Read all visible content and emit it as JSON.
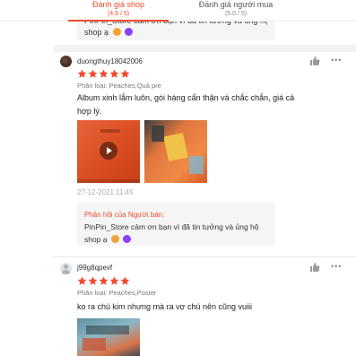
{
  "tabs": {
    "shop": {
      "label": "Đánh giá shop",
      "score": "(4.9 / 5)"
    },
    "buyer": {
      "label": "Đánh giá người mua",
      "score": "(5.0 / 5)"
    }
  },
  "top_reply": {
    "line1": "PinPin_Store cảm ơn bạn vì đã tin tưởng và ủng hộ",
    "line2": "shop ạ"
  },
  "reviews": [
    {
      "username": "duongthuy18042006",
      "rating": 5,
      "variant": "Phân loại: Peaches,Quà pre",
      "text": "Album xinh lắm luôn, gói hàng cẩn thận và chắc chắn, giá cả hợp lý.",
      "media": [
        "video",
        "image"
      ],
      "timestamp": "27-12-2021 11:45",
      "reply": {
        "title": "Phản hồi của Người bán:",
        "text_line1": "PinPin_Store cảm ơn bạn vì đã tin tưởng và ủng hộ",
        "text_line2": "shop ạ"
      }
    },
    {
      "username": "j99g8qpevf",
      "rating": 5,
      "variant": "Phân loại: Peaches,Poster",
      "text": "ko ra chú kim nhưng mà ra vợ chú nên cũng  vuiii",
      "media": [
        "image"
      ]
    }
  ],
  "icons": {
    "like": "thumbs-up-icon",
    "more": "more-options-icon",
    "star": "star-icon",
    "play": "play-icon",
    "emoji_face": "smiling-face-emoji",
    "emoji_heart": "purple-heart-emoji"
  },
  "colors": {
    "accent": "#ee4d2d",
    "star": "#ee4d2d",
    "reply_bg": "#f5f5f5",
    "muted": "#888888",
    "emoji_purple": "#8a3ffc"
  }
}
